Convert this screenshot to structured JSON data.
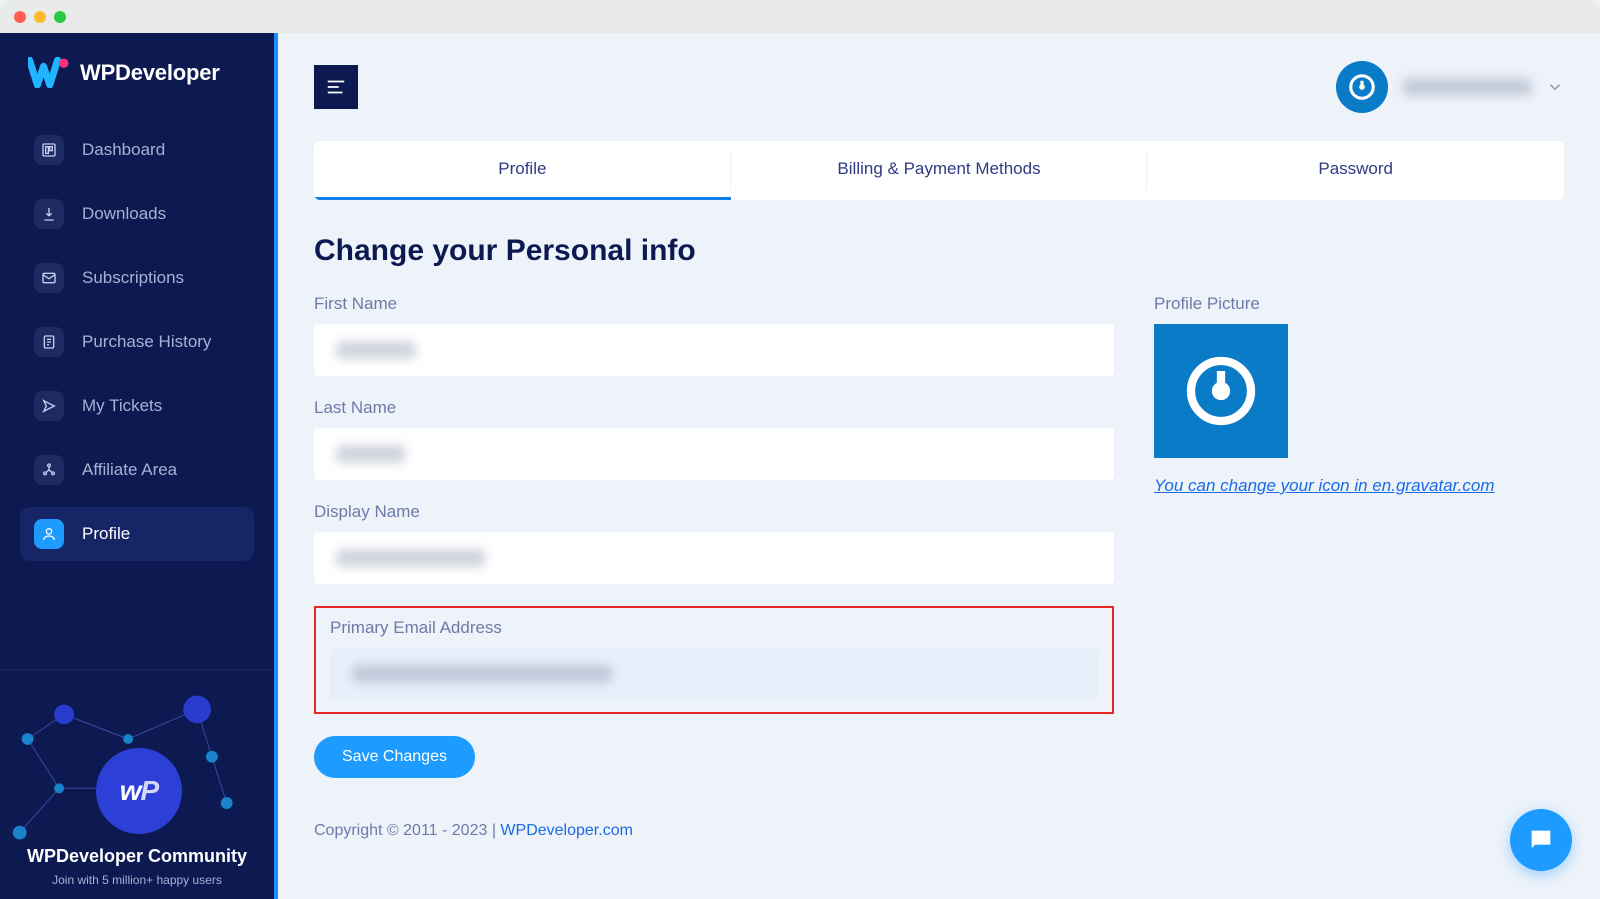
{
  "brand": "WPDeveloper",
  "sidebar": {
    "items": [
      {
        "label": "Dashboard"
      },
      {
        "label": "Downloads"
      },
      {
        "label": "Subscriptions"
      },
      {
        "label": "Purchase History"
      },
      {
        "label": "My Tickets"
      },
      {
        "label": "Affiliate Area"
      },
      {
        "label": "Profile"
      }
    ],
    "community_title": "WPDeveloper Community",
    "community_sub": "Join with 5 million+ happy users"
  },
  "tabs": {
    "profile": "Profile",
    "billing": "Billing & Payment Methods",
    "password": "Password"
  },
  "page_title": "Change your Personal info",
  "fields": {
    "first_name": "First Name",
    "last_name": "Last Name",
    "display_name": "Display Name",
    "primary_email": "Primary Email Address",
    "profile_picture": "Profile Picture"
  },
  "values": {
    "first_name": "",
    "last_name": "",
    "display_name": "",
    "primary_email": ""
  },
  "gravatar_link": "You can change your icon in en.gravatar.com",
  "save_label": "Save Changes",
  "footer": {
    "copyright": "Copyright © 2011 - 2023 | ",
    "site": "WPDeveloper.com"
  }
}
